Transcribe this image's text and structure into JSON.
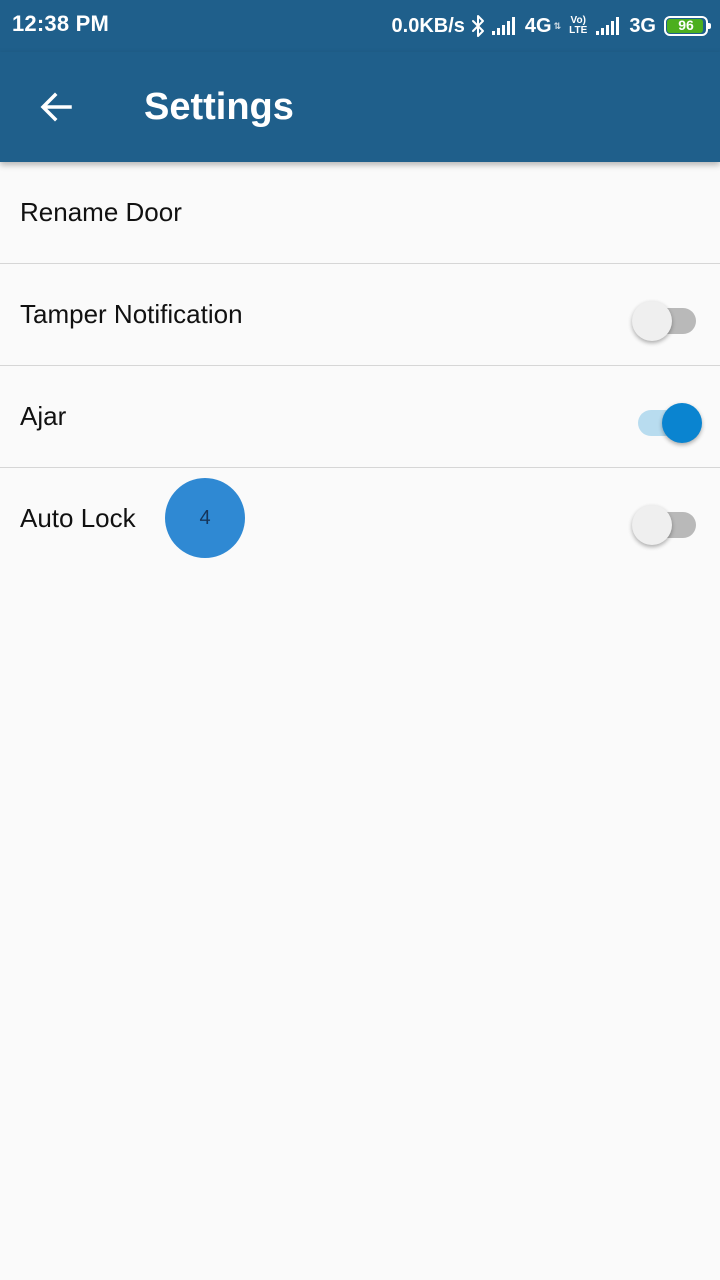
{
  "status_bar": {
    "time": "12:38 PM",
    "net_speed": "0.0KB/s",
    "network1": "4G",
    "volte_top": "Vo)",
    "volte_bottom": "LTE",
    "network2": "3G",
    "battery": "96",
    "battery_level": 0.96,
    "icons": [
      "bluetooth-icon",
      "signal-icon",
      "data-arrows-icon",
      "volte-icon",
      "signal-icon",
      "battery-icon"
    ]
  },
  "app_bar": {
    "back_icon": "arrow-left-icon",
    "title": "Settings"
  },
  "settings": {
    "items": [
      {
        "label": "Rename Door"
      },
      {
        "label": "Tamper Notification",
        "toggle": false
      },
      {
        "label": "Ajar",
        "toggle": true
      },
      {
        "label": "Auto Lock",
        "toggle": false
      }
    ]
  },
  "touch_indicator": {
    "count": "4"
  },
  "colors": {
    "primary": "#1f5f8b",
    "background": "#fafafa",
    "switch_on_thumb": "#0a84d0",
    "switch_on_track": "#b8dcef",
    "switch_off_thumb": "#efefef",
    "switch_off_track": "#b9b9b9",
    "battery_fill": "#4caf1e",
    "touch_indicator": "#2f89d3"
  }
}
